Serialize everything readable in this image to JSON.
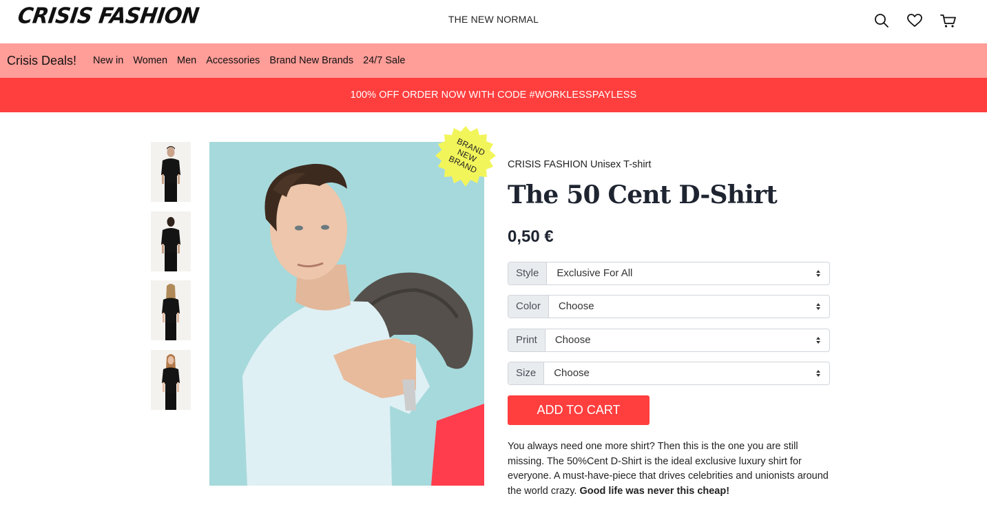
{
  "header": {
    "logo": "CRISIS FASHION",
    "tagline": "THE NEW NORMAL",
    "icons": [
      "search-icon",
      "heart-icon",
      "cart-icon"
    ]
  },
  "nav": {
    "brand": "Crisis Deals!",
    "items": [
      "New in",
      "Women",
      "Men",
      "Accessories",
      "Brand New Brands",
      "24/7 Sale"
    ]
  },
  "promo": {
    "text": "100% OFF ORDER NOW WITH CODE #WORKLESSPAYLESS"
  },
  "gallery": {
    "badge_lines": [
      "BRAND",
      "NEW",
      "BRAND"
    ]
  },
  "product": {
    "brand": "CRISIS FASHION Unisex T-shirt",
    "title": "The 50 Cent D-Shirt",
    "price": "0,50 €",
    "options": [
      {
        "label": "Style",
        "value": "Exclusive For All"
      },
      {
        "label": "Color",
        "value": "Choose"
      },
      {
        "label": "Print",
        "value": "Choose"
      },
      {
        "label": "Size",
        "value": "Choose"
      }
    ],
    "add_to_cart": "ADD TO CART",
    "description": "You always need one more shirt? Then this is the one you are still missing. The 50%Cent D-Shirt is the ideal exclusive luxury shirt for everyone. A must-have-piece that drives celebrities and unionists around the world crazy.",
    "description_bold": "Good life was never this cheap!"
  },
  "colors": {
    "nav_bg": "#ff9d98",
    "promo_bg": "#ff3e3e",
    "accent": "#ff3e3e",
    "badge": "#f2f55a",
    "photo_bg": "#a6d9dc"
  }
}
